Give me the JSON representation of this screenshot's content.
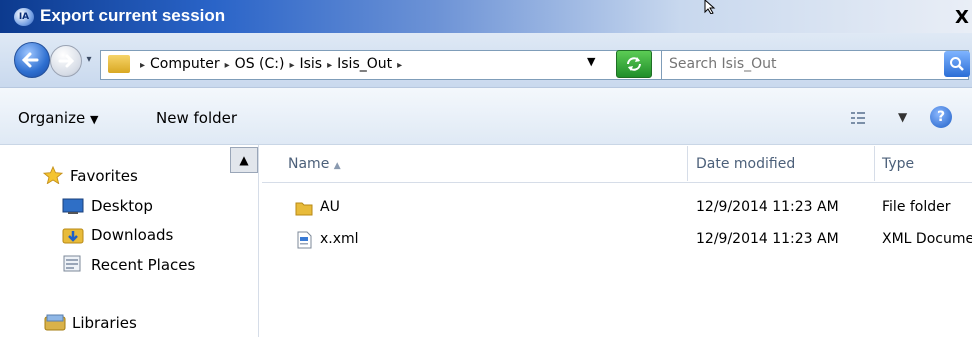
{
  "window": {
    "title": "Export current session",
    "close_label": "X"
  },
  "address_bar": {
    "crumbs": [
      "Computer",
      "OS (C:)",
      "Isis",
      "Isis_Out"
    ],
    "nav_dropdown": "▾"
  },
  "search": {
    "placeholder": "Search Isis_Out"
  },
  "toolbar": {
    "organize_label": "Organize",
    "new_folder_label": "New folder"
  },
  "nav_pane": {
    "favorites_label": "Favorites",
    "items": [
      "Desktop",
      "Downloads",
      "Recent Places"
    ],
    "libraries_label": "Libraries"
  },
  "columns": {
    "name": "Name",
    "date_modified": "Date modified",
    "type": "Type"
  },
  "files": [
    {
      "name": "AU",
      "date": "12/9/2014 11:23 AM",
      "type": "File folder",
      "icon": "folder-icon"
    },
    {
      "name": "x.xml",
      "date": "12/9/2014 11:23 AM",
      "type": "XML Docume",
      "icon": "xml-file-icon"
    }
  ],
  "colors": {
    "title_bar": "#0c3a8e",
    "accent": "#2e6fd0",
    "folder": "#e8bb3a",
    "header_text": "#4c607a"
  }
}
